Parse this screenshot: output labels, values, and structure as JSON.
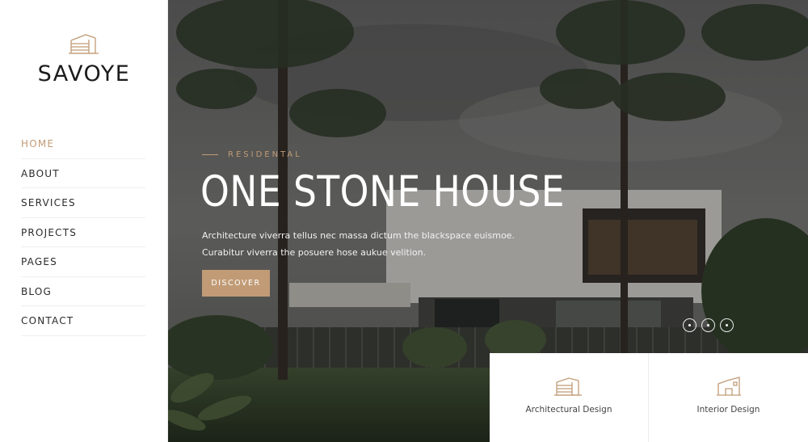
{
  "brand": {
    "name": "SAVOYE",
    "icon": "house-outline-icon"
  },
  "nav": {
    "items": [
      {
        "label": "HOME",
        "active": true
      },
      {
        "label": "ABOUT"
      },
      {
        "label": "SERVICES"
      },
      {
        "label": "PROJECTS"
      },
      {
        "label": "PAGES"
      },
      {
        "label": "BLOG"
      },
      {
        "label": "CONTACT"
      }
    ]
  },
  "hero": {
    "kicker": "RESIDENTAL",
    "title": "ONE STONE HOUSE",
    "description_line1": "Architecture viverra tellus nec massa dictum the blackspace euismoe.",
    "description_line2": "Curabitur viverra the posuere hose aukue velition.",
    "button_label": "DISCOVER",
    "slides": 3
  },
  "services": [
    {
      "label": "Architectural Design",
      "icon": "building-outline-icon"
    },
    {
      "label": "Interior Design",
      "icon": "interior-house-icon"
    }
  ],
  "colors": {
    "accent": "#c19b76",
    "text": "#2b2b2b",
    "white": "#ffffff"
  }
}
